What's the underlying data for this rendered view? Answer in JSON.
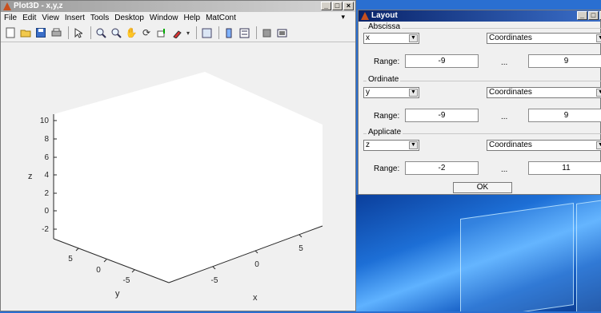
{
  "plot_window": {
    "title": "Plot3D - x,y,z",
    "menu": [
      "File",
      "Edit",
      "View",
      "Insert",
      "Tools",
      "Desktop",
      "Window",
      "Help",
      "MatCont"
    ]
  },
  "axes": {
    "zlabel": "z",
    "ylabel": "y",
    "xlabel": "x",
    "z_ticks": [
      "10",
      "8",
      "6",
      "4",
      "2",
      "0",
      "-2"
    ],
    "y_ticks": [
      "5",
      "0",
      "-5"
    ],
    "x_ticks": [
      "5",
      "0",
      "-5"
    ]
  },
  "layout_window": {
    "title": "Layout",
    "range_label": "Range:",
    "dots": "...",
    "ok_label": "OK",
    "groups": [
      {
        "label": "Abscissa",
        "variable": "x",
        "mode": "Coordinates",
        "min": "-9",
        "max": "9"
      },
      {
        "label": "Ordinate",
        "variable": "y",
        "mode": "Coordinates",
        "min": "-9",
        "max": "9"
      },
      {
        "label": "Applicate",
        "variable": "z",
        "mode": "Coordinates",
        "min": "-2",
        "max": "11"
      }
    ]
  },
  "colors": {
    "layout_title_bar": "#0a246a",
    "plot_title_bar": "#9c9c9c",
    "axes_face": "#ffffff"
  }
}
